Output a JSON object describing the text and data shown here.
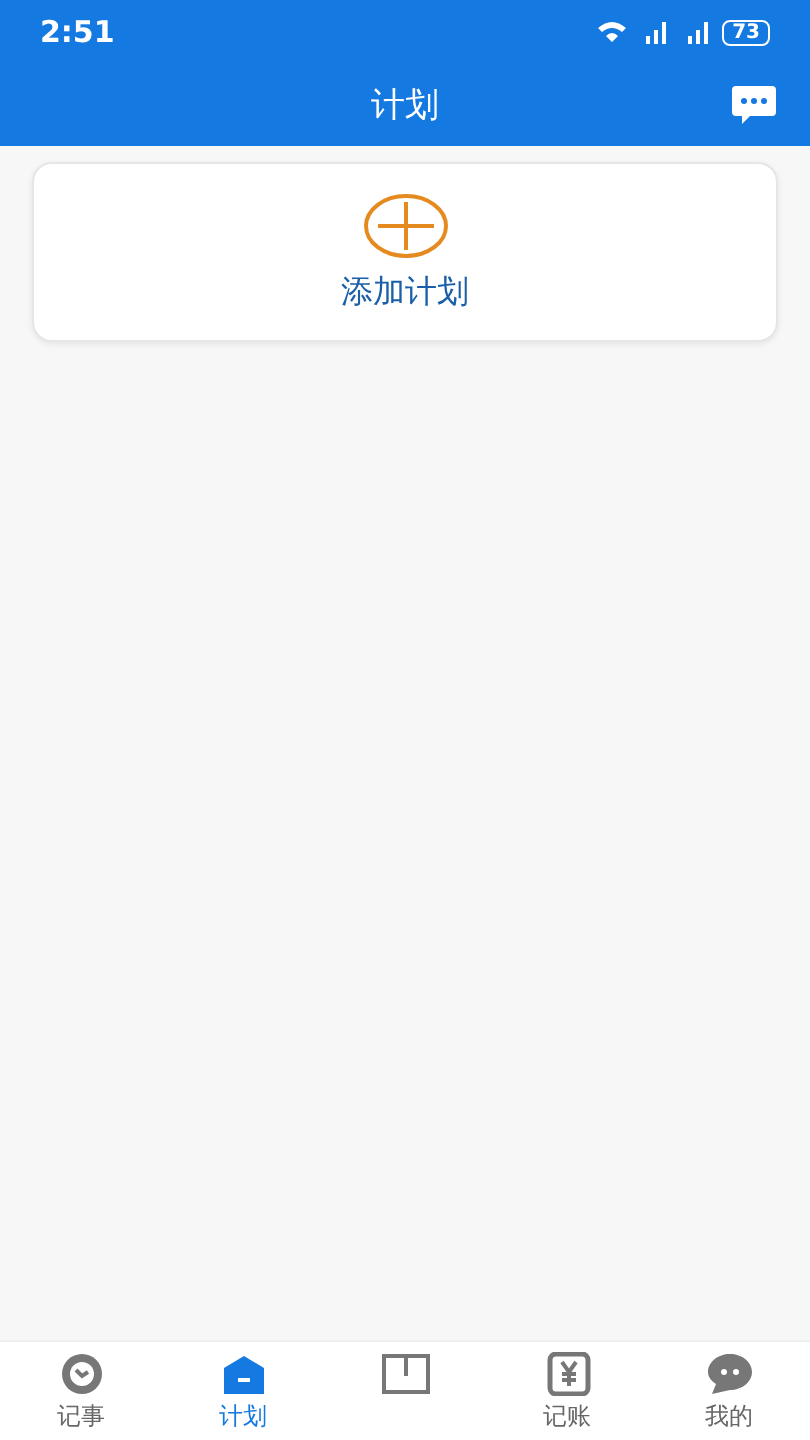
{
  "status_bar": {
    "time": "2:51",
    "battery": "73"
  },
  "header": {
    "title": "计划"
  },
  "add_card": {
    "label": "添加计划"
  },
  "tabs": [
    {
      "kind": "clock",
      "label": "记事",
      "selected": false
    },
    {
      "kind": "box",
      "label": "计划",
      "selected": true
    },
    {
      "kind": "board",
      "selected": false
    },
    {
      "kind": "money",
      "label": "记账",
      "selected": false
    },
    {
      "kind": "chat",
      "label": "我的",
      "selected": false
    }
  ]
}
